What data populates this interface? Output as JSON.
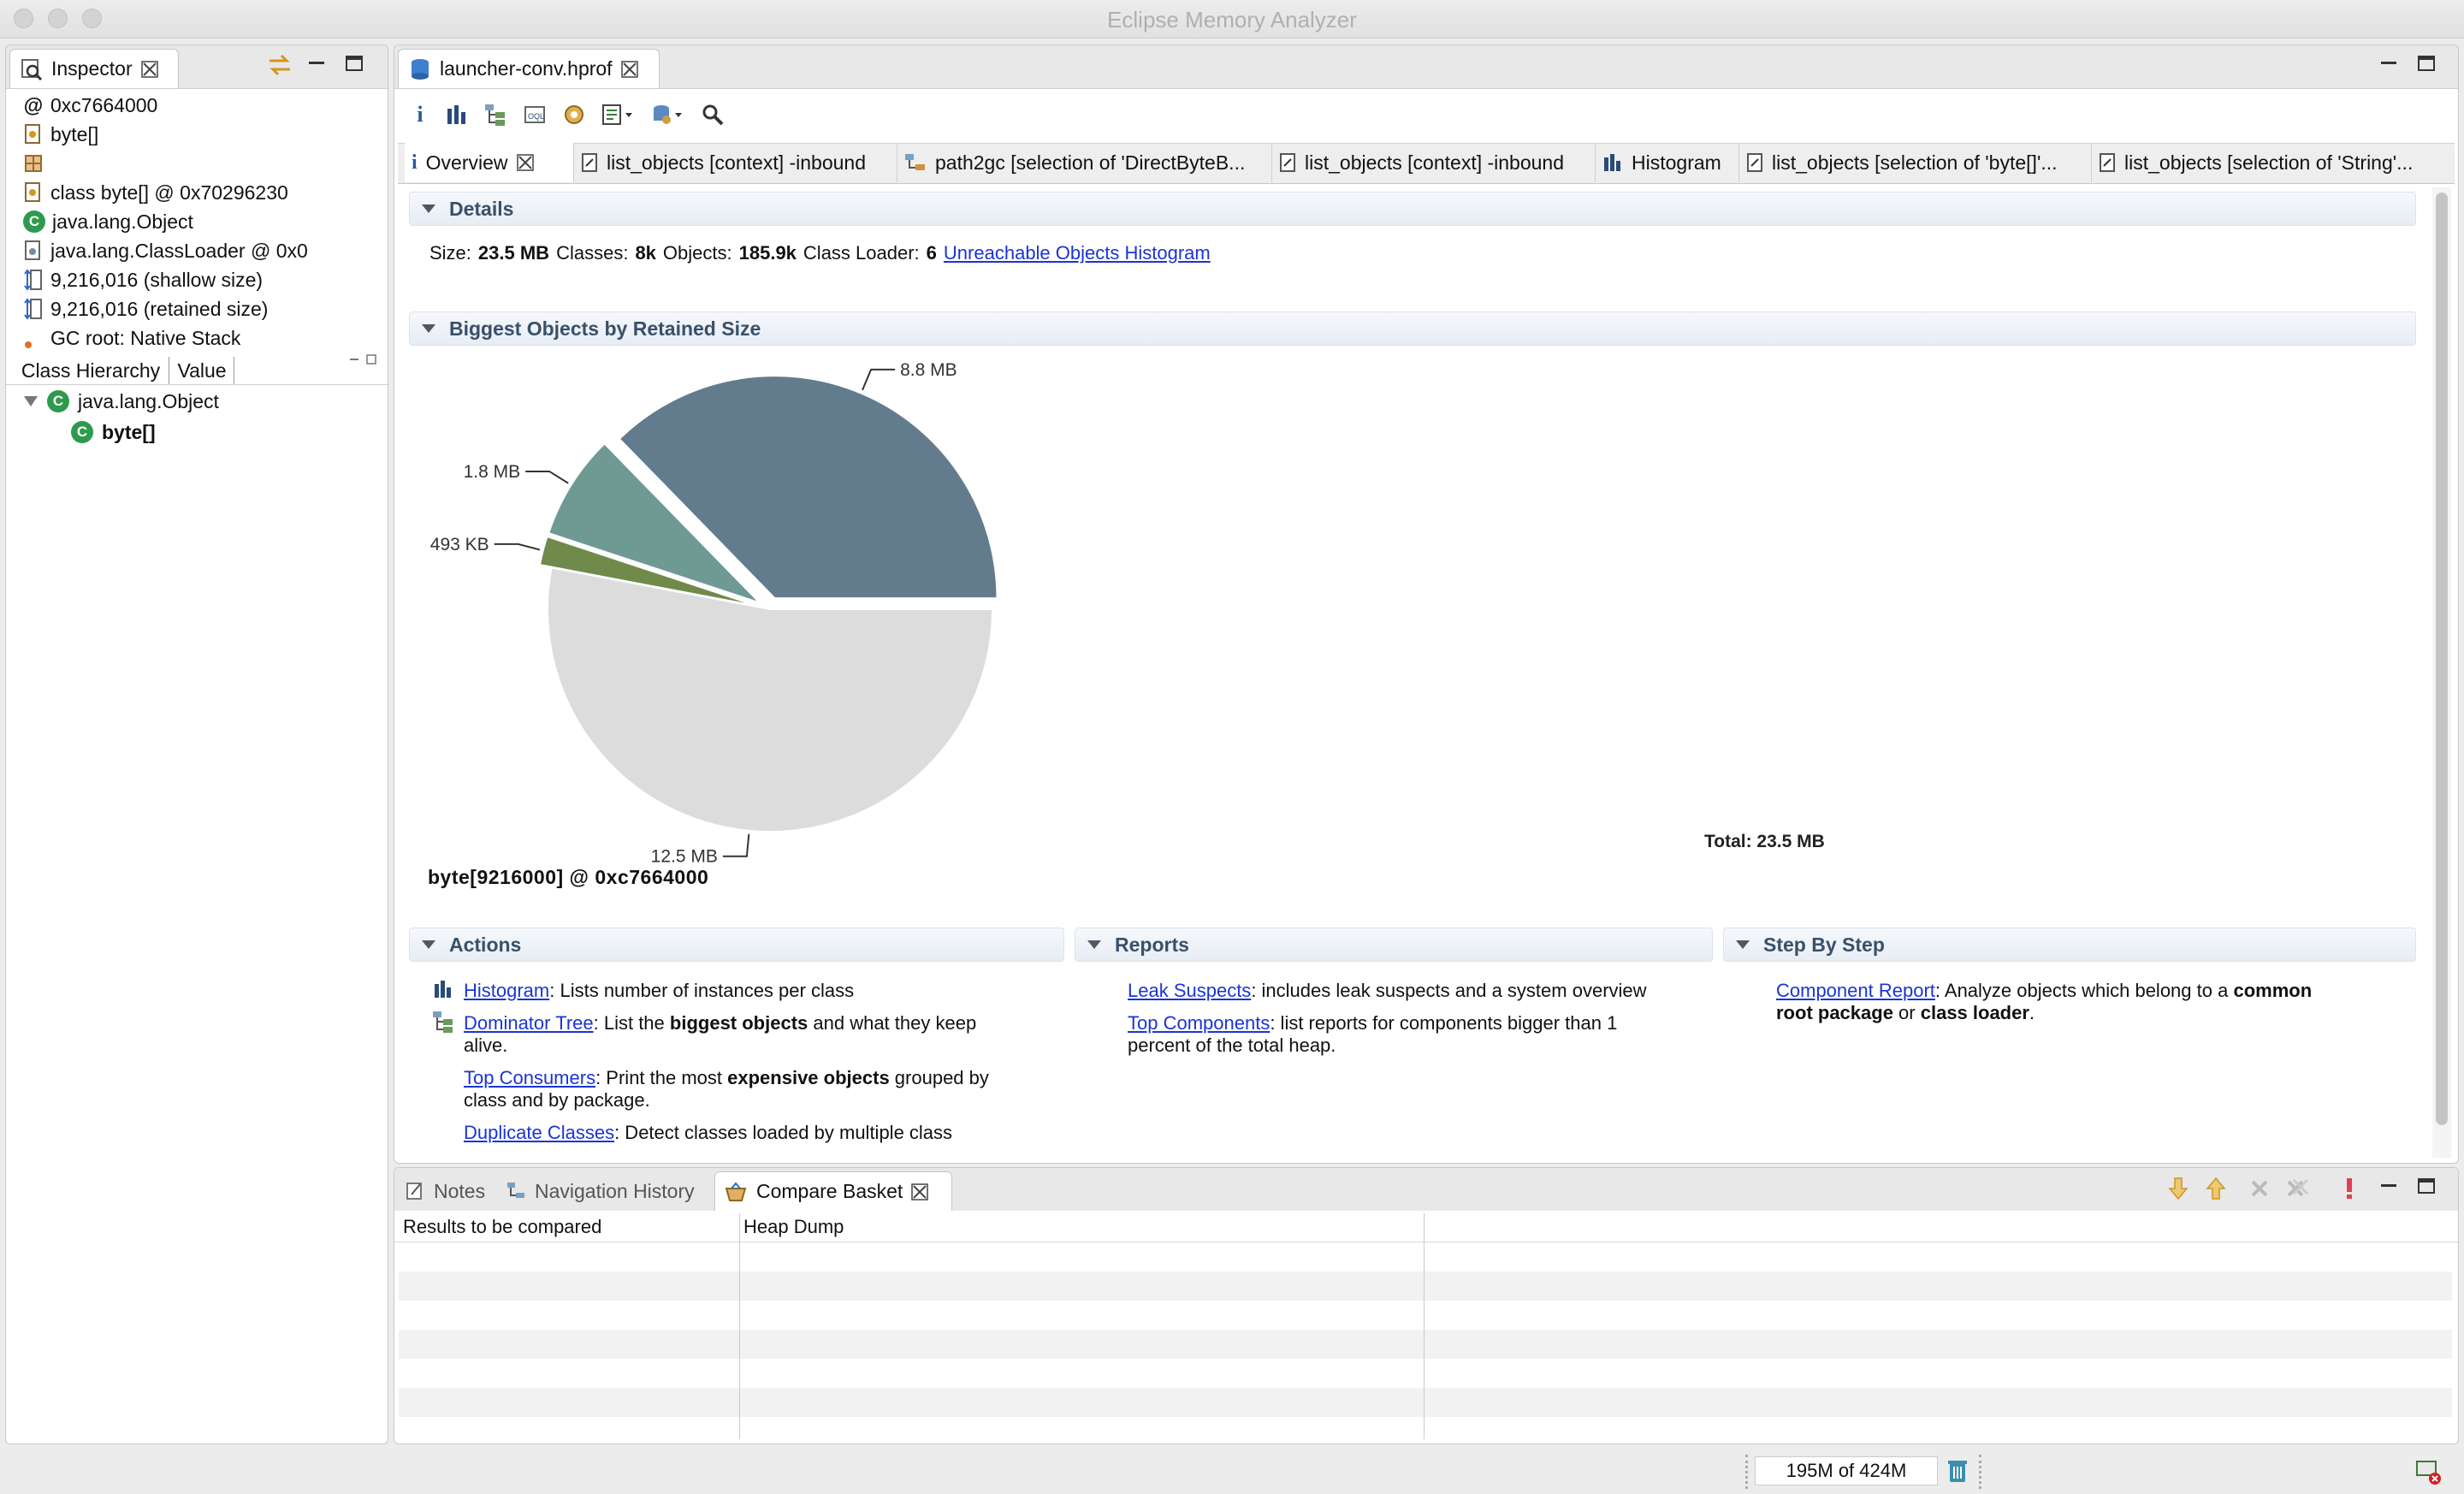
{
  "window": {
    "title": "Eclipse Memory Analyzer"
  },
  "inspector": {
    "tab_label": "Inspector",
    "rows": [
      {
        "icon": "at-icon",
        "text": "0xc7664000"
      },
      {
        "icon": "class-file-icon",
        "text": "byte[]"
      },
      {
        "icon": "package-grid-icon",
        "text": ""
      },
      {
        "icon": "class-file-icon",
        "text": "class byte[] @ 0x70296230"
      },
      {
        "icon": "static-class-icon",
        "text": "java.lang.Object"
      },
      {
        "icon": "classloader-icon",
        "text": "java.lang.ClassLoader @ 0x0"
      },
      {
        "icon": "shallow-size-icon",
        "text": "9,216,016 (shallow size)"
      },
      {
        "icon": "retained-size-icon",
        "text": "9,216,016 (retained size)"
      },
      {
        "icon": "gc-root-icon",
        "text": "GC root: Native Stack"
      }
    ],
    "subtabs": [
      "Class Hierarchy",
      "Value"
    ],
    "tree": [
      {
        "label": "java.lang.Object",
        "bold": false
      },
      {
        "label": "byte[]",
        "bold": true
      }
    ]
  },
  "editor": {
    "file_tab": "launcher-conv.hprof",
    "tabs": [
      {
        "label": "Overview",
        "icon": "info-icon"
      },
      {
        "label": "list_objects [context] -inbound",
        "icon": "query-icon"
      },
      {
        "label": "path2gc [selection of 'DirectByteB...",
        "icon": "path-icon"
      },
      {
        "label": "list_objects [context] -inbound",
        "icon": "query-icon"
      },
      {
        "label": "Histogram",
        "icon": "histogram-icon"
      },
      {
        "label": "list_objects [selection of 'byte[]'...",
        "icon": "query-icon"
      },
      {
        "label": "list_objects [selection of 'String'...",
        "icon": "query-icon"
      }
    ]
  },
  "details": {
    "header": "Details",
    "size_label": "Size:",
    "size_value": "23.5 MB",
    "classes_label": "Classes:",
    "classes_value": "8k",
    "objects_label": "Objects:",
    "objects_value": "185.9k",
    "loader_label": "Class Loader:",
    "loader_value": "6",
    "link": "Unreachable Objects Histogram"
  },
  "biggest": {
    "header": "Biggest Objects by Retained Size",
    "selected_object": "byte[9216000] @ 0xc7664000"
  },
  "chart_data": {
    "type": "pie",
    "title": "",
    "total_label": "Total: 23.5 MB",
    "slices": [
      {
        "label": "8.8 MB",
        "value": 8.8,
        "color": "#627c8e",
        "exploded": true
      },
      {
        "label": "1.8 MB",
        "value": 1.8,
        "color": "#6f9a94",
        "exploded": true
      },
      {
        "label": "493 KB",
        "value": 0.493,
        "color": "#6f8a4a",
        "exploded": true
      },
      {
        "label": "12.5 MB",
        "value": 12.5,
        "color": "#dcdcdc",
        "exploded": false
      }
    ]
  },
  "actions": {
    "header": "Actions",
    "items": [
      {
        "link": "Histogram",
        "text": ": Lists number of instances per class",
        "icon": "histogram-icon"
      },
      {
        "link": "Dominator Tree",
        "text_pre": ": List the ",
        "bold": "biggest objects",
        "text_post": " and what they keep",
        "line2": "alive.",
        "icon": "dominator-tree-icon"
      },
      {
        "link": "Top Consumers",
        "text_pre": ": Print the most ",
        "bold": "expensive objects",
        "text_post": " grouped by",
        "line2": "class and by package."
      },
      {
        "link": "Duplicate Classes",
        "text": ": Detect classes loaded by multiple class"
      }
    ]
  },
  "reports": {
    "header": "Reports",
    "items": [
      {
        "link": "Leak Suspects",
        "text": ": includes leak suspects and a system overview"
      },
      {
        "link": "Top Components",
        "text": ": list reports for components bigger than 1",
        "line2": "percent of the total heap."
      }
    ]
  },
  "step": {
    "header": "Step By Step",
    "link": "Component Report",
    "text_pre": ": Analyze objects which belong to a ",
    "bold1": "common",
    "bold2": "root package",
    "mid": " or ",
    "bold3": "class loader",
    "end": "."
  },
  "bottom": {
    "tabs": [
      "Notes",
      "Navigation History",
      "Compare Basket"
    ],
    "columns": [
      "Results to be compared",
      "Heap Dump"
    ]
  },
  "status": {
    "heap": "195M of 424M"
  }
}
